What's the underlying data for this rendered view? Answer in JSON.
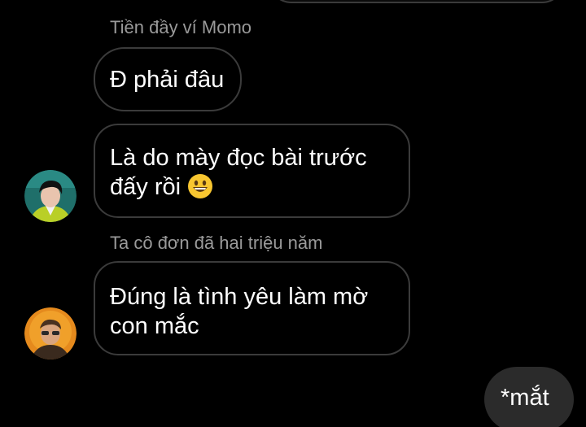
{
  "messages": [
    {
      "sender": "Tiền đầy ví Momo",
      "text": "Đ phải đâu"
    },
    {
      "line1": "Là do mày đọc bài trước",
      "line2": "đấy rồi"
    },
    {
      "sender": "Ta cô đơn đã hai triệu năm",
      "line1": "Đúng là tình yêu làm mờ",
      "line2": "con mắc"
    }
  ],
  "own_message": {
    "text": "*mắt"
  },
  "emoji": {
    "name": "grinning-face-emoji"
  }
}
